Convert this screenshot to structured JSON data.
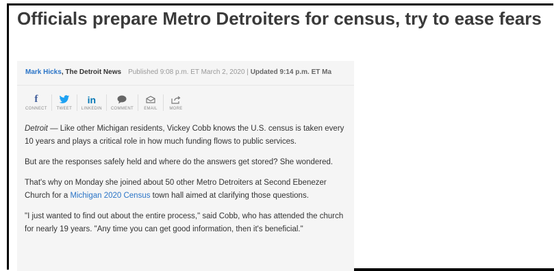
{
  "article": {
    "headline": "Officials prepare Metro Detroiters for census, try to ease fears",
    "byline": {
      "author": "Mark Hicks",
      "org": ", The Detroit News",
      "published": "Published 9:08 p.m. ET March 2, 2020 | ",
      "updated": "Updated 9:14 p.m. ET Ma"
    },
    "share": [
      {
        "icon": "f",
        "label": "CONNECT",
        "color": "#3b5998"
      },
      {
        "icon": "twitter",
        "label": "TWEET",
        "color": "#1da1f2"
      },
      {
        "icon": "in",
        "label": "LINKEDIN",
        "color": "#0077b5"
      },
      {
        "icon": "comment",
        "label": "COMMENT",
        "color": "#666666"
      },
      {
        "icon": "email",
        "label": "EMAIL",
        "color": "#666666"
      },
      {
        "icon": "more",
        "label": "MORE",
        "color": "#666666"
      }
    ],
    "paragraphs": {
      "p1_dateline": "Detroit",
      "p1_text": " — Like other Michigan residents, Vickey Cobb knows the U.S. census is taken every 10 years and plays a critical role in how much funding flows to public services.",
      "p2": "But are the responses safely held and where do the answers get stored? She wondered.",
      "p3_before": "That's why on Monday she joined about 50 other Metro Detroiters at Second Ebenezer Church for a ",
      "p3_link": "Michigan 2020 Census",
      "p3_after": " town hall aimed at clarifying those questions.",
      "p4": "\"I just wanted to find out about the entire process,\" said Cobb, who has attended the church for nearly 19 years. \"Any time you can get good information, then it's beneficial.\""
    }
  }
}
